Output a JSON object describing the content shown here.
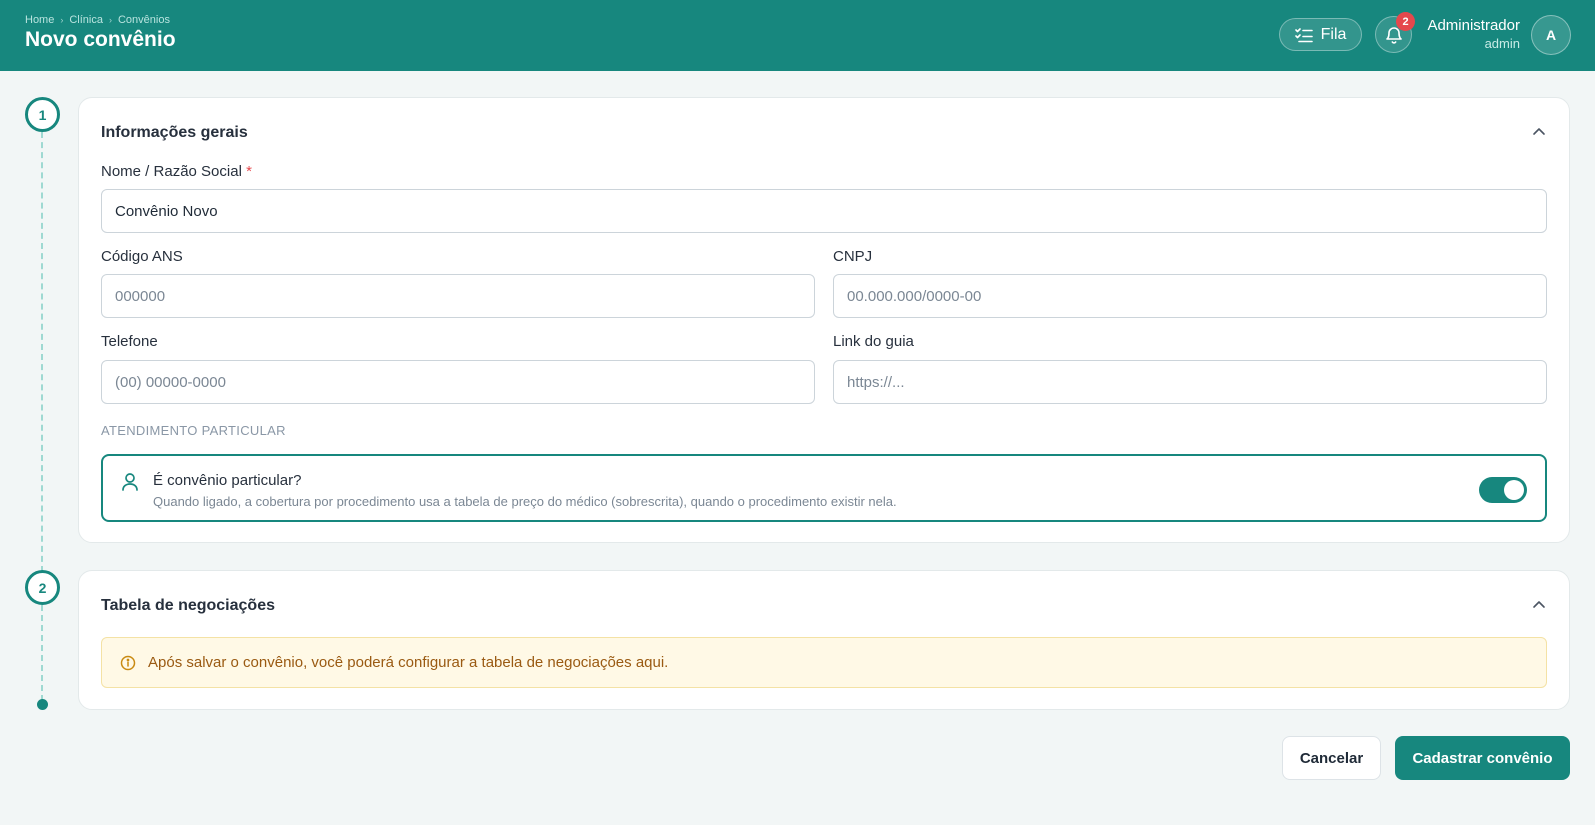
{
  "header": {
    "breadcrumb": [
      "Home",
      "Clínica",
      "Convênios"
    ],
    "breadcrumb_separator": "›",
    "title": "Novo convênio",
    "queue_button_label": "Fila",
    "notifications_count": "2",
    "user": {
      "name": "Administrador",
      "role": "admin",
      "initial": "A"
    },
    "colors": {
      "brand": "#17877e",
      "badge": "#e5484d"
    }
  },
  "steps": [
    "1",
    "2"
  ],
  "general_info": {
    "title": "Informações gerais",
    "name_label": "Nome / Razão Social",
    "required_marker": "*",
    "name_value": "Convênio Novo",
    "ans_label": "Código ANS",
    "ans_placeholder": "000000",
    "cnpj_label": "CNPJ",
    "cnpj_placeholder": "00.000.000/0000-00",
    "phone_label": "Telefone",
    "phone_placeholder": "(00) 00000-0000",
    "guide_link_label": "Link do guia",
    "guide_link_placeholder": "https://...",
    "private_section_label": "ATENDIMENTO PARTICULAR",
    "private_title": "É convênio particular?",
    "private_description": "Quando ligado, a cobertura por procedimento usa a tabela de preço do médico (sobrescrita), quando o procedimento existir nela.",
    "private_enabled": true
  },
  "negotiations": {
    "title": "Tabela de negociações",
    "info": "Após salvar o convênio, você poderá configurar a tabela de negociações aqui."
  },
  "actions": {
    "cancel_label": "Cancelar",
    "submit_label": "Cadastrar convênio"
  }
}
